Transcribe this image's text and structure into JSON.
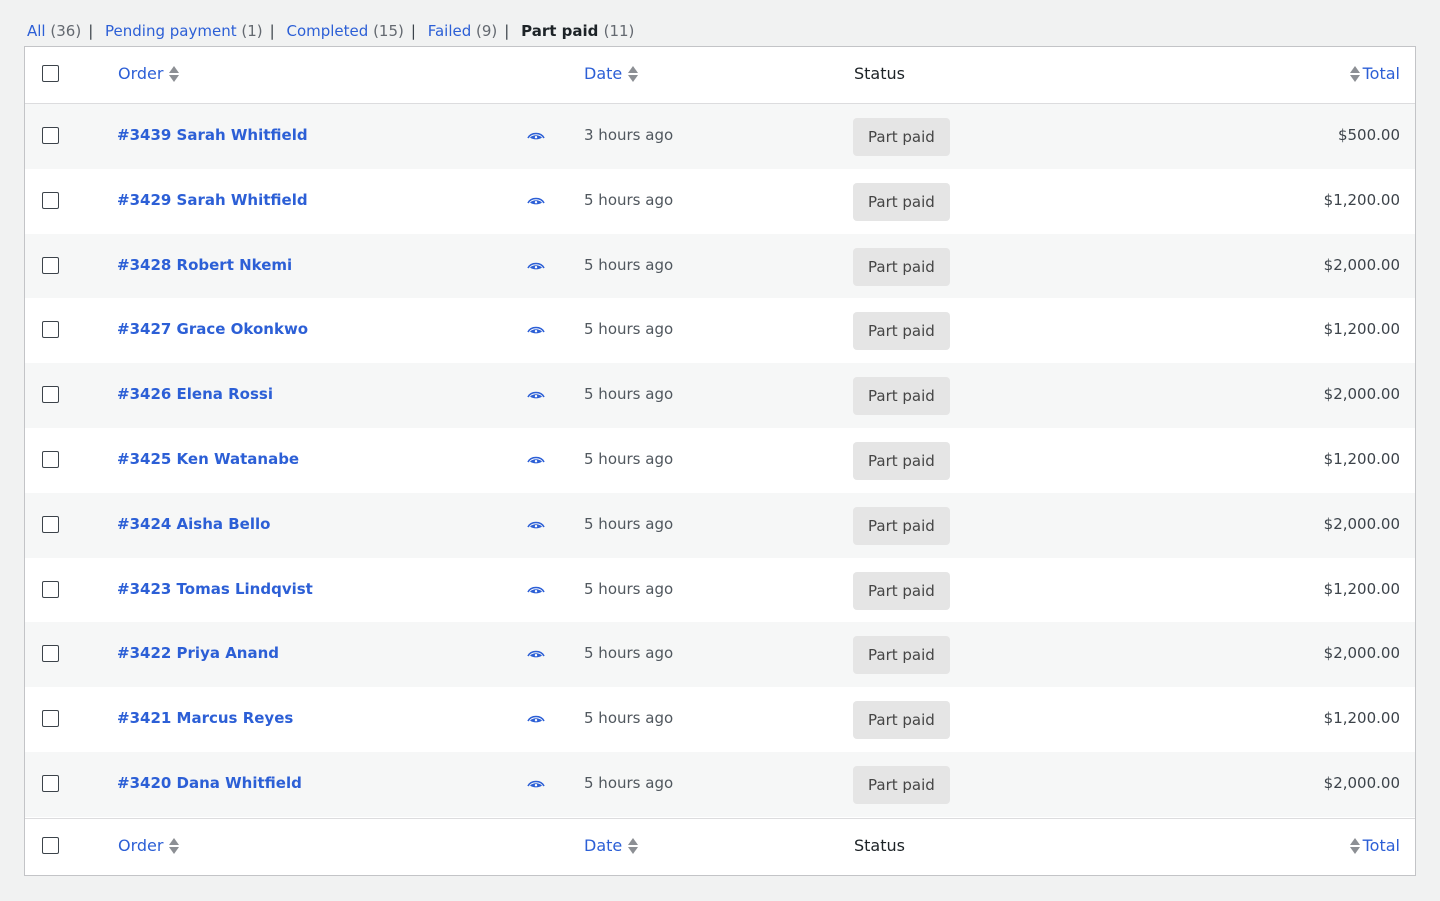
{
  "filters": [
    {
      "label": "All",
      "count": "(36)"
    },
    {
      "label": "Pending payment",
      "count": "(1)"
    },
    {
      "label": "Completed",
      "count": "(15)"
    },
    {
      "label": "Failed",
      "count": "(9)"
    }
  ],
  "current_filter": {
    "label": "Part paid",
    "count": "(11)"
  },
  "separator": "|",
  "columns": {
    "order": "Order",
    "date": "Date",
    "status": "Status",
    "total": "Total"
  },
  "icons": {
    "sort": "sort-arrows-icon",
    "preview": "eye-icon",
    "checkbox": "checkbox"
  },
  "colors": {
    "link": "#2c5fd6",
    "status_bg": "#e5e5e5",
    "row_alt": "#f6f7f7"
  },
  "orders": [
    {
      "order": "#3439 Sarah Whitfield",
      "date": "3 hours ago",
      "status": "Part paid",
      "total": "$500.00"
    },
    {
      "order": "#3429 Sarah Whitfield",
      "date": "5 hours ago",
      "status": "Part paid",
      "total": "$1,200.00"
    },
    {
      "order": "#3428 Robert Nkemi",
      "date": "5 hours ago",
      "status": "Part paid",
      "total": "$2,000.00"
    },
    {
      "order": "#3427 Grace Okonkwo",
      "date": "5 hours ago",
      "status": "Part paid",
      "total": "$1,200.00"
    },
    {
      "order": "#3426 Elena Rossi",
      "date": "5 hours ago",
      "status": "Part paid",
      "total": "$2,000.00"
    },
    {
      "order": "#3425 Ken Watanabe",
      "date": "5 hours ago",
      "status": "Part paid",
      "total": "$1,200.00"
    },
    {
      "order": "#3424 Aisha Bello",
      "date": "5 hours ago",
      "status": "Part paid",
      "total": "$2,000.00"
    },
    {
      "order": "#3423 Tomas Lindqvist",
      "date": "5 hours ago",
      "status": "Part paid",
      "total": "$1,200.00"
    },
    {
      "order": "#3422 Priya Anand",
      "date": "5 hours ago",
      "status": "Part paid",
      "total": "$2,000.00"
    },
    {
      "order": "#3421 Marcus Reyes",
      "date": "5 hours ago",
      "status": "Part paid",
      "total": "$1,200.00"
    },
    {
      "order": "#3420 Dana Whitfield",
      "date": "5 hours ago",
      "status": "Part paid",
      "total": "$2,000.00"
    }
  ]
}
